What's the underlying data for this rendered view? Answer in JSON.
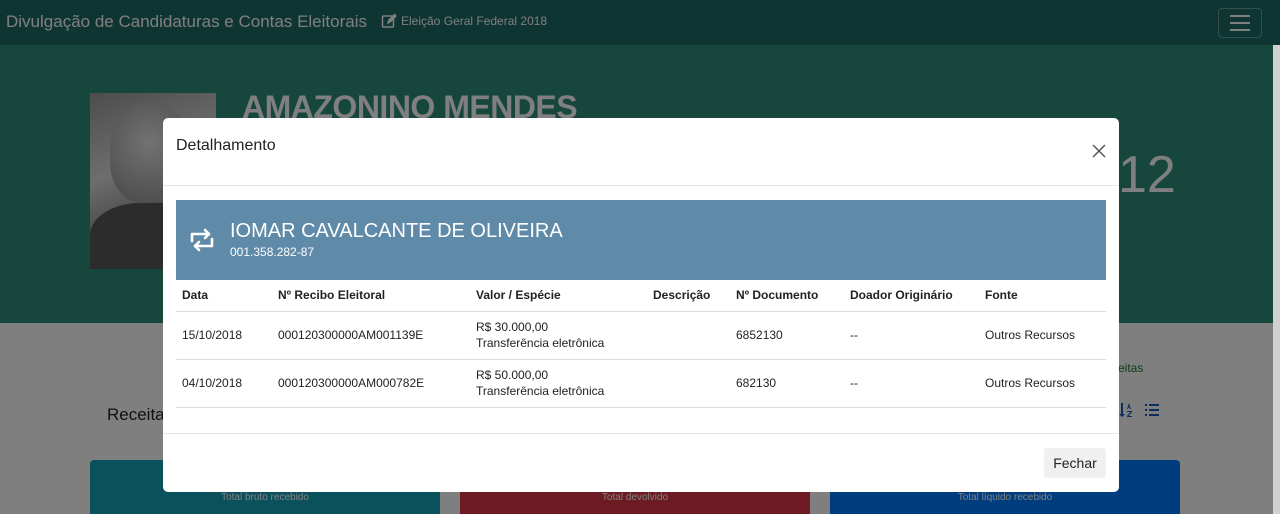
{
  "navbar": {
    "brand": "Divulgação de Candidaturas e Contas Eleitorais",
    "election": "Eleição Geral Federal 2018"
  },
  "hero": {
    "candidate_name": "AMAZONINO MENDES",
    "candidate_number": "12"
  },
  "page": {
    "receitas_link": "ceitas",
    "receitas_title": "Receita",
    "cards": [
      {
        "label": "Total bruto recebido"
      },
      {
        "label": "Total devolvido"
      },
      {
        "label": "Total líquido recebido"
      }
    ]
  },
  "modal": {
    "title": "Detalhamento",
    "donor_name": "IOMAR CAVALCANTE DE OLIVEIRA",
    "donor_doc": "001.358.282-87",
    "columns": [
      "Data",
      "Nº Recibo Eleitoral",
      "Valor / Espécie",
      "Descrição",
      "Nº Documento",
      "Doador Originário",
      "Fonte"
    ],
    "rows": [
      {
        "data": "15/10/2018",
        "recibo": "000120300000AM001139E",
        "valor": "R$ 30.000,00",
        "especie": "Transferência eletrônica",
        "descricao": "",
        "documento": "6852130",
        "doador": "--",
        "fonte": "Outros Recursos"
      },
      {
        "data": "04/10/2018",
        "recibo": "000120300000AM000782E",
        "valor": "R$ 50.000,00",
        "especie": "Transferência eletrônica",
        "descricao": "",
        "documento": "682130",
        "doador": "--",
        "fonte": "Outros Recursos"
      }
    ],
    "close_label": "Fechar"
  },
  "colors": {
    "navbar": "#1d6a64",
    "hero": "#2c8d78",
    "donor_header": "#5f8aa8"
  }
}
